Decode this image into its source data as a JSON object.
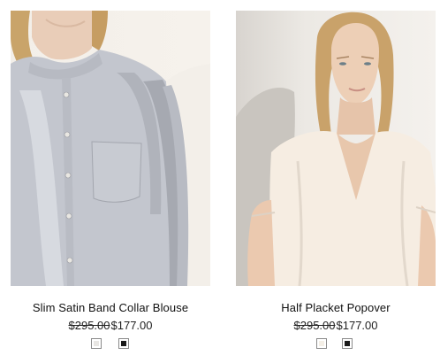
{
  "products": [
    {
      "name": "Slim Satin Band Collar Blouse",
      "original_price": "$295.00",
      "sale_price": "$177.00",
      "swatches": [
        {
          "label": "light",
          "color": "#e8e6e3"
        },
        {
          "label": "black",
          "color": "#1a1a1a"
        }
      ]
    },
    {
      "name": "Half Placket Popover",
      "original_price": "$295.00",
      "sale_price": "$177.00",
      "swatches": [
        {
          "label": "off-white",
          "color": "#f4efe6"
        },
        {
          "label": "black",
          "color": "#1a1a1a"
        }
      ]
    }
  ]
}
